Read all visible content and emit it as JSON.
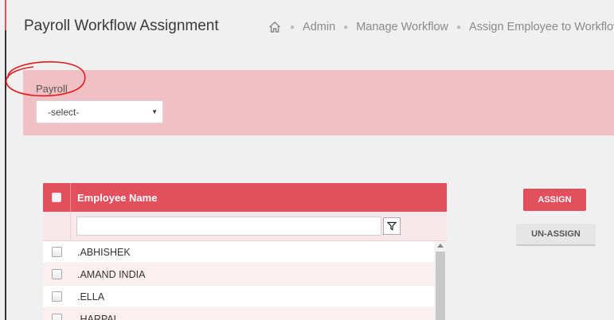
{
  "header": {
    "title": "Payroll Workflow Assignment",
    "breadcrumb": [
      "Admin",
      "Manage Workflow",
      "Assign Employee to Workflow"
    ]
  },
  "filter": {
    "payroll_label": "Payroll",
    "payroll_select_value": "-select-"
  },
  "grid": {
    "column_header": "Employee Name",
    "filter_value": "",
    "rows": [
      ".ABHISHEK",
      ".AMAND INDIA",
      ".ELLA",
      ".HARPAL"
    ]
  },
  "actions": {
    "assign_label": "ASSIGN",
    "unassign_label": "UN-ASSIGN"
  },
  "colors": {
    "accent": "#e2505e",
    "panel": "#f0c0c4",
    "annotation": "#e01b1b"
  }
}
